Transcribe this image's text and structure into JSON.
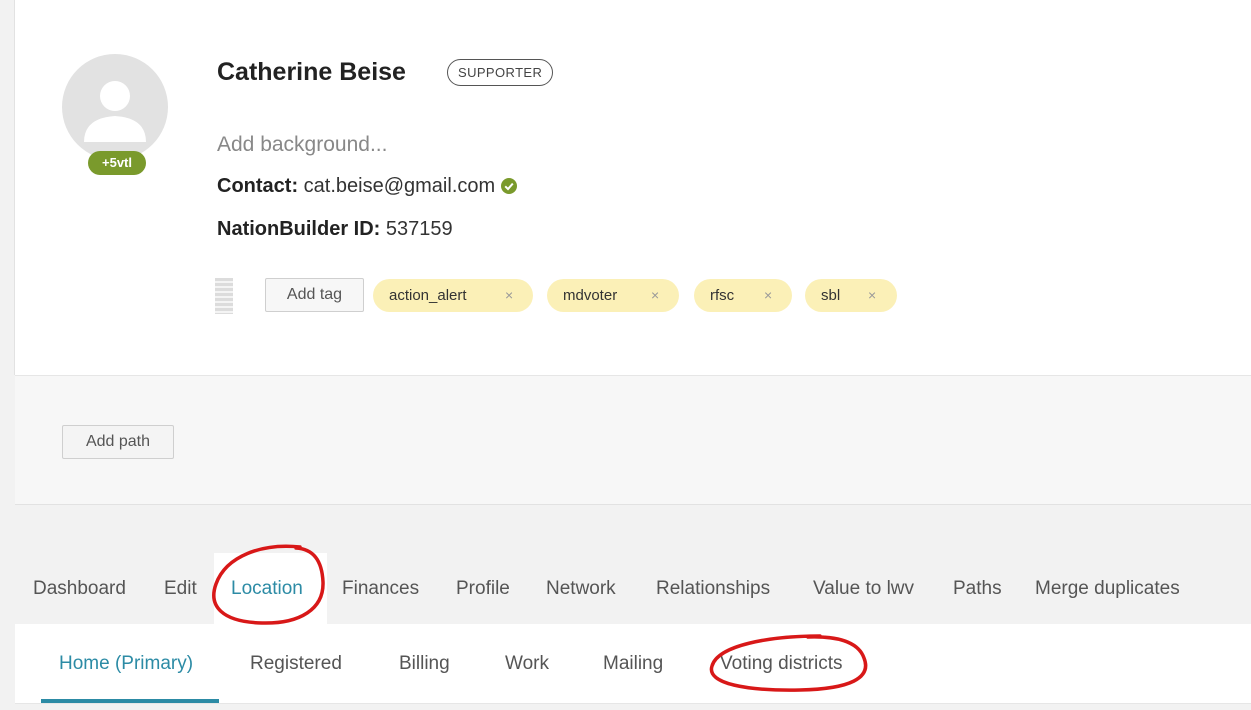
{
  "profile": {
    "name": "Catherine Beise",
    "role": "SUPPORTER",
    "badge": "+5vtl",
    "background_placeholder": "Add background...",
    "contact_label": "Contact:",
    "contact_email": "cat.beise@gmail.com",
    "nbid_label": "NationBuilder ID:",
    "nbid_value": "537159"
  },
  "tags": {
    "add_label": "Add tag",
    "items": [
      {
        "label": "action_alert",
        "remove": "×"
      },
      {
        "label": "mdvoter",
        "remove": "×"
      },
      {
        "label": "rfsc",
        "remove": "×"
      },
      {
        "label": "sbl",
        "remove": "×"
      }
    ]
  },
  "path": {
    "add_label": "Add path"
  },
  "main_tabs": [
    {
      "label": "Dashboard"
    },
    {
      "label": "Edit"
    },
    {
      "label": "Location",
      "active": true
    },
    {
      "label": "Finances"
    },
    {
      "label": "Profile"
    },
    {
      "label": "Network"
    },
    {
      "label": "Relationships"
    },
    {
      "label": "Value to lwv"
    },
    {
      "label": "Paths"
    },
    {
      "label": "Merge duplicates"
    }
  ],
  "sub_tabs": [
    {
      "label": "Home (Primary)",
      "active": true
    },
    {
      "label": "Registered"
    },
    {
      "label": "Billing"
    },
    {
      "label": "Work"
    },
    {
      "label": "Mailing"
    },
    {
      "label": "Voting districts"
    }
  ],
  "colors": {
    "accent": "#2c8ba5",
    "badge": "#7a9a2c",
    "tag_bg": "#fbf0b7",
    "verified": "#7a9a2c",
    "annotation": "#d81818"
  },
  "icons": {
    "avatar": "person-silhouette-icon",
    "verified": "check-circle-icon",
    "drag": "drag-handle-icon"
  }
}
